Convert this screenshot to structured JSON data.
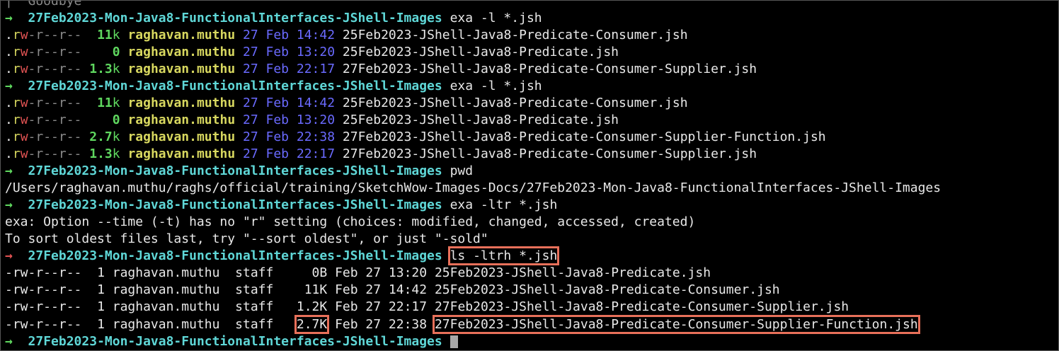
{
  "prompt": {
    "arrow": "→",
    "directory": "27Feb2023-Mon-Java8-FunctionalInterfaces-JShell-Images"
  },
  "top_fragment": "|  Goodbye",
  "commands": {
    "exa_l_1": "exa -l *.jsh",
    "exa_l_2": "exa -l *.jsh",
    "pwd": "pwd",
    "exa_ltr": "exa -ltr *.jsh",
    "ls": "ls -ltrh *.jsh"
  },
  "exa_listing_1": [
    {
      "dot": ".",
      "r1": "r",
      "w": "w",
      "rest": "-r--r--",
      "size": "11",
      "unit": "k",
      "user": "raghavan.muthu",
      "date": "27 Feb 14:42",
      "name": "25Feb2023-JShell-Java8-Predicate-Consumer.jsh"
    },
    {
      "dot": ".",
      "r1": "r",
      "w": "w",
      "rest": "-r--r--",
      "size": "0",
      "unit": "",
      "user": "raghavan.muthu",
      "date": "27 Feb 13:20",
      "name": "25Feb2023-JShell-Java8-Predicate.jsh"
    },
    {
      "dot": ".",
      "r1": "r",
      "w": "w",
      "rest": "-r--r--",
      "size": "1.3",
      "unit": "k",
      "user": "raghavan.muthu",
      "date": "27 Feb 22:17",
      "name": "27Feb2023-JShell-Java8-Predicate-Consumer-Supplier.jsh"
    }
  ],
  "exa_listing_2": [
    {
      "dot": ".",
      "r1": "r",
      "w": "w",
      "rest": "-r--r--",
      "size": "11",
      "unit": "k",
      "user": "raghavan.muthu",
      "date": "27 Feb 14:42",
      "name": "25Feb2023-JShell-Java8-Predicate-Consumer.jsh"
    },
    {
      "dot": ".",
      "r1": "r",
      "w": "w",
      "rest": "-r--r--",
      "size": "0",
      "unit": "",
      "user": "raghavan.muthu",
      "date": "27 Feb 13:20",
      "name": "25Feb2023-JShell-Java8-Predicate.jsh"
    },
    {
      "dot": ".",
      "r1": "r",
      "w": "w",
      "rest": "-r--r--",
      "size": "2.7",
      "unit": "k",
      "user": "raghavan.muthu",
      "date": "27 Feb 22:38",
      "name": "27Feb2023-JShell-Java8-Predicate-Consumer-Supplier-Function.jsh"
    },
    {
      "dot": ".",
      "r1": "r",
      "w": "w",
      "rest": "-r--r--",
      "size": "1.3",
      "unit": "k",
      "user": "raghavan.muthu",
      "date": "27 Feb 22:17",
      "name": "27Feb2023-JShell-Java8-Predicate-Consumer-Supplier.jsh"
    }
  ],
  "pwd_output": "/Users/raghavan.muthu/raghs/official/training/SketchWow-Images-Docs/27Feb2023-Mon-Java8-FunctionalInterfaces-JShell-Images",
  "exa_error": [
    "exa: Option --time (-t) has no \"r\" setting (choices: modified, changed, accessed, created)",
    "To sort oldest files last, try \"--sort oldest\", or just \"-sold\""
  ],
  "ls_listing": [
    {
      "perms": "-rw-r--r--",
      "links": "1",
      "user": "raghavan.muthu",
      "group": "staff",
      "size": "0B",
      "date": "Feb 27 13:20",
      "name": "25Feb2023-JShell-Java8-Predicate.jsh"
    },
    {
      "perms": "-rw-r--r--",
      "links": "1",
      "user": "raghavan.muthu",
      "group": "staff",
      "size": "11K",
      "date": "Feb 27 14:42",
      "name": "25Feb2023-JShell-Java8-Predicate-Consumer.jsh"
    },
    {
      "perms": "-rw-r--r--",
      "links": "1",
      "user": "raghavan.muthu",
      "group": "staff",
      "size": "1.2K",
      "date": "Feb 27 22:17",
      "name": "27Feb2023-JShell-Java8-Predicate-Consumer-Supplier.jsh"
    },
    {
      "perms": "-rw-r--r--",
      "links": "1",
      "user": "raghavan.muthu",
      "group": "staff",
      "size": "2.7K",
      "date": "Feb 27 22:38",
      "name": "27Feb2023-JShell-Java8-Predicate-Consumer-Supplier-Function.jsh"
    }
  ],
  "colors": {
    "background": "#000000",
    "prompt_ok": "#5fd75f",
    "prompt_err": "#e05252",
    "directory": "#5fd7d7",
    "user": "#d7d75f",
    "date": "#6a6aff",
    "highlight_box": "#e8705a"
  }
}
